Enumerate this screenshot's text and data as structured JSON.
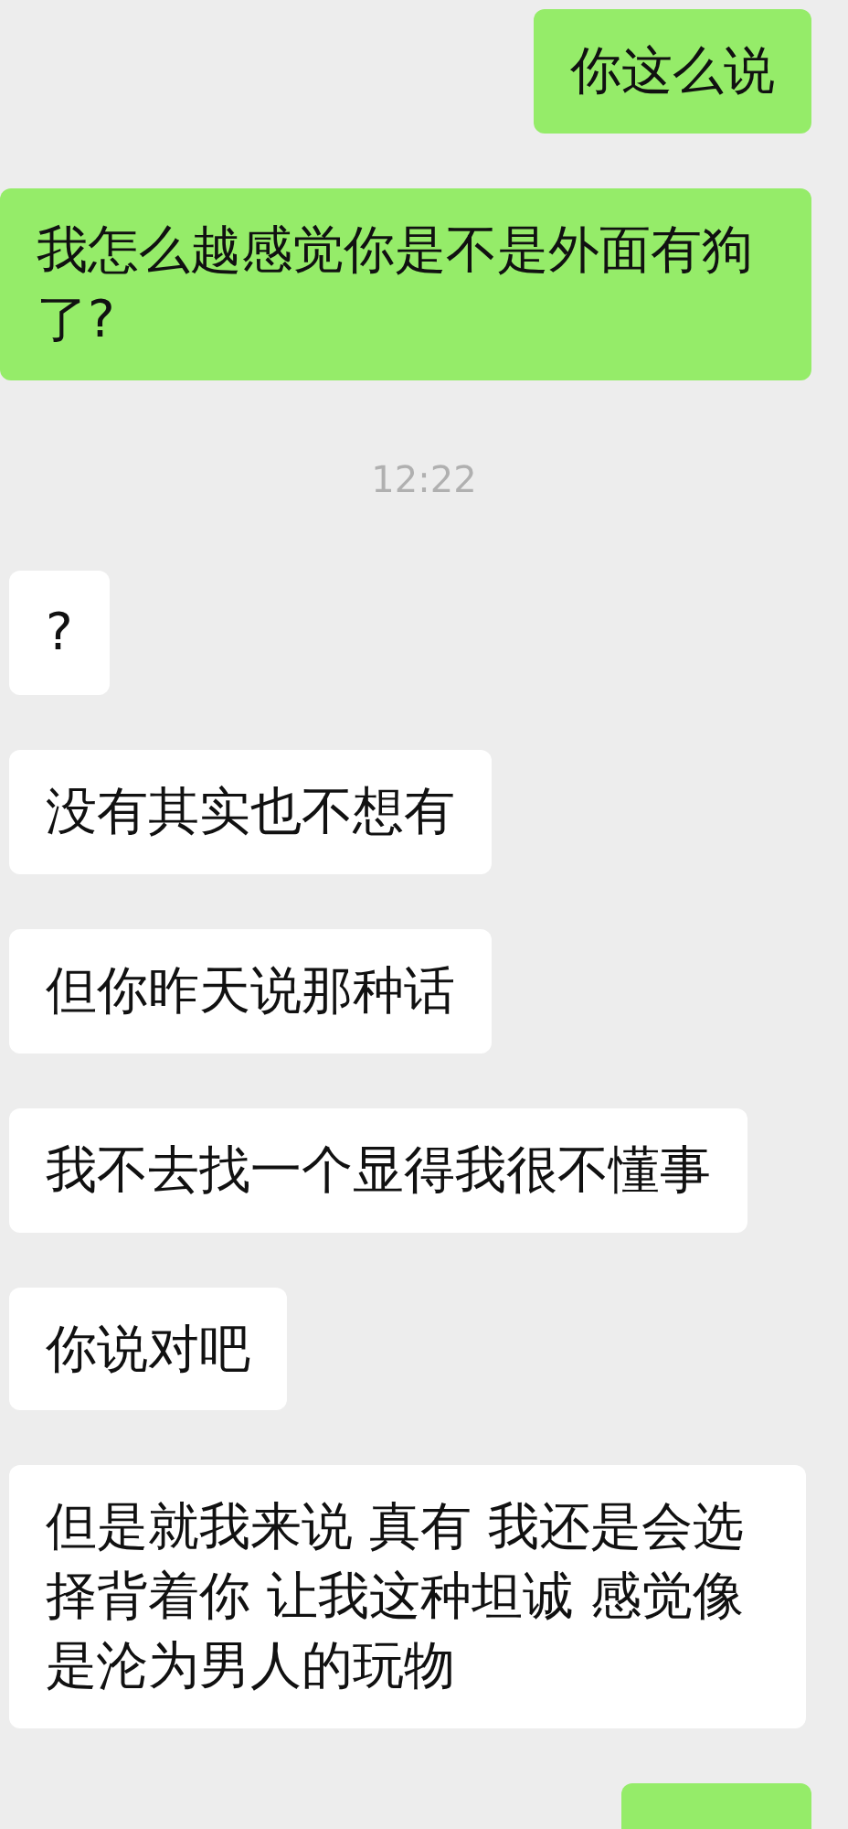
{
  "messages": [
    {
      "kind": "sent",
      "text": "你这么说"
    },
    {
      "kind": "sent",
      "text": "我怎么越感觉你是不是外面有狗了?"
    },
    {
      "kind": "time",
      "text": "12:22"
    },
    {
      "kind": "received",
      "text": "?"
    },
    {
      "kind": "received",
      "text": "没有其实也不想有"
    },
    {
      "kind": "received",
      "text": "但你昨天说那种话"
    },
    {
      "kind": "received",
      "text": "我不去找一个显得我很不懂事"
    },
    {
      "kind": "received",
      "text": "你说对吧"
    },
    {
      "kind": "received",
      "text": "但是就我来说 真有 我还是会选择背着你 让我这种坦诚 感觉像是沦为男人的玩物"
    },
    {
      "kind": "sent"
    }
  ]
}
